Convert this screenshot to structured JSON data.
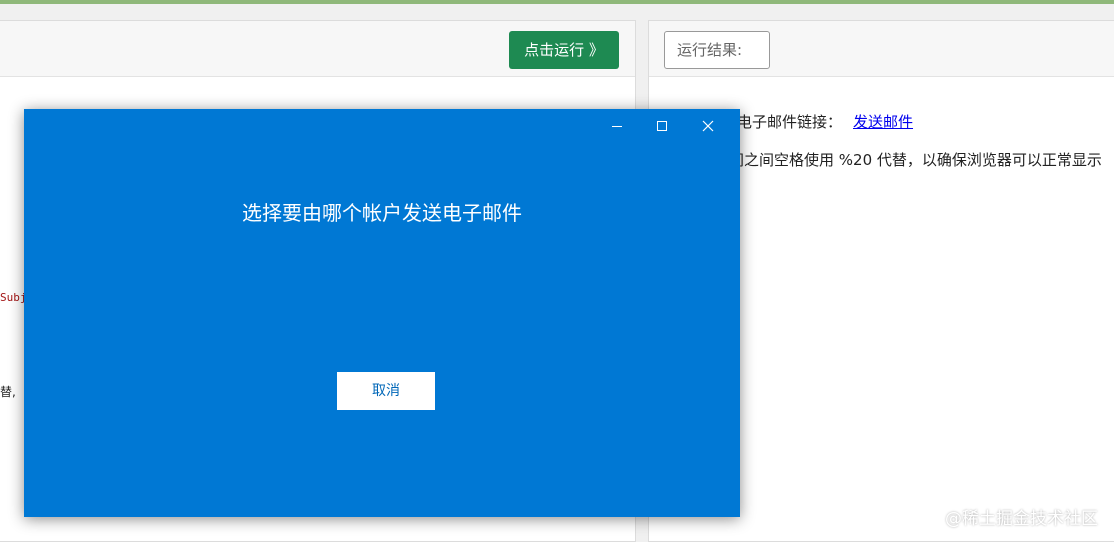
{
  "editor": {
    "run_button": "点击运行 》",
    "code_fragment_subject": "Subj",
    "code_fragment_text": "替,"
  },
  "result": {
    "label": "运行结果:",
    "line1_prefix": "电子邮件链接：",
    "line1_link": "发送邮件",
    "line2": "间之间空格使用 %20 代替，以确保浏览器可以正常显示"
  },
  "dialog": {
    "title": "选择要由哪个帐户发送电子邮件",
    "cancel": "取消",
    "controls": [
      "minimize-icon",
      "maximize-icon",
      "close-icon"
    ]
  },
  "watermark": "@稀土掘金技术社区",
  "colors": {
    "dialog_bg": "#0078d4",
    "run_button_bg": "#1e8a52",
    "link": "#0000ee",
    "top_strip": "#8fb87a"
  }
}
